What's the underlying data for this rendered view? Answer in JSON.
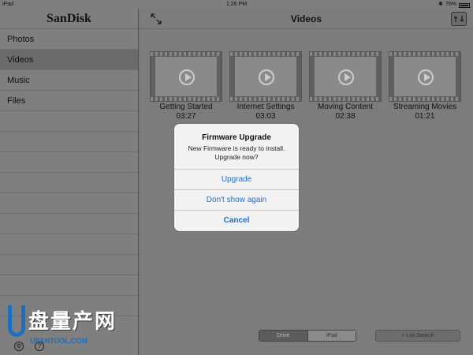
{
  "status_bar": {
    "device": "iPad",
    "time": "1:26 PM",
    "battery": "76%",
    "wifi_icon": "wifi-icon",
    "bluetooth_icon": "bluetooth-icon"
  },
  "sidebar": {
    "app_name": "SanDisk",
    "items": [
      {
        "label": "Photos",
        "selected": false
      },
      {
        "label": "Videos",
        "selected": true
      },
      {
        "label": "Music",
        "selected": false
      },
      {
        "label": "Files",
        "selected": false
      }
    ],
    "footer_icons": [
      "gear-icon",
      "help-icon"
    ]
  },
  "main": {
    "title": "Videos",
    "videos": [
      {
        "name": "Getting Started",
        "duration": "03:27"
      },
      {
        "name": "Internet Settings",
        "duration": "03:03"
      },
      {
        "name": "Moving Content",
        "duration": "02:38"
      },
      {
        "name": "Streaming Movies",
        "duration": "01:21"
      }
    ]
  },
  "bottom_bar": {
    "segment": [
      "Drive",
      "iPad"
    ],
    "list_search": "List Search"
  },
  "dialog": {
    "title": "Firmware Upgrade",
    "message_line1": "New Firmware is ready to install.",
    "message_line2": "Upgrade now?",
    "buttons": {
      "upgrade": "Upgrade",
      "dont_show": "Don't show again",
      "cancel": "Cancel"
    }
  },
  "watermark": {
    "text": "盘量产网",
    "url": "UPANTOOL.COM"
  },
  "colors": {
    "dialog_button": "#1f6fd1",
    "watermark_blue": "#1a6fc2"
  }
}
